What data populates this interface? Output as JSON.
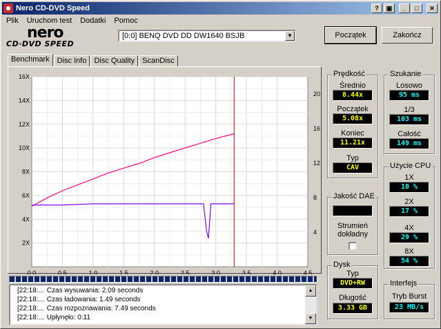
{
  "window": {
    "title": "Nero CD-DVD Speed",
    "buttons": {
      "help": "?",
      "minimize": "_",
      "maximize": "□",
      "close": "✕"
    }
  },
  "menu": [
    "Plik",
    "Uruchom test",
    "Dodatki",
    "Pomoc"
  ],
  "logo": {
    "brand": "nero",
    "product": "CD·DVD SPEED"
  },
  "drive": {
    "selected": "[0:0]  BENQ DVD DD DW1640 BSJB"
  },
  "actions": {
    "start": "Początek",
    "exit": "Zakończ"
  },
  "tabs": [
    "Benchmark",
    "Disc Info",
    "Disc Quality",
    "ScanDisc"
  ],
  "speed": {
    "title": "Prędkość",
    "average_label": "Średnio",
    "average": "8.44x",
    "start_label": "Początek",
    "start": "5.08x",
    "end_label": "Koniec",
    "end": "11.21x",
    "type_label": "Typ",
    "type": "CAV"
  },
  "seek": {
    "title": "Szukanie",
    "random_label": "Losowo",
    "random": "95 ms",
    "third_label": "1/3",
    "third": "103 ms",
    "full_label": "Całość",
    "full": "149 ms"
  },
  "cpu": {
    "title": "Użycie CPU",
    "rows": [
      {
        "label": "1X",
        "value": "10 %"
      },
      {
        "label": "2X",
        "value": "17 %"
      },
      {
        "label": "4X",
        "value": "29 %"
      },
      {
        "label": "8X",
        "value": "54 %"
      }
    ]
  },
  "dae": {
    "title": "Jakość DAE",
    "stream_label": "Strumień dokładny"
  },
  "disc": {
    "title": "Dysk",
    "type_label": "Typ",
    "type": "DVD+RW",
    "length_label": "Długość",
    "length": "3.33 GB"
  },
  "interface": {
    "title": "Interfejs",
    "burst_label": "Tryb Burst",
    "burst": "23 MB/s"
  },
  "progress": {
    "fraction": 1.0
  },
  "log": [
    {
      "ts": "[22:18:...",
      "msg": "Czas wysuwania: 2.09 seconds"
    },
    {
      "ts": "[22:18:...",
      "msg": "Czas ładowania: 1.49 seconds"
    },
    {
      "ts": "[22:18:...",
      "msg": "Czas rozpoznawania: 7.49 seconds"
    },
    {
      "ts": "[22:18:...",
      "msg": "Upłynęło:  0:11"
    }
  ],
  "chart_data": {
    "type": "line",
    "x_ticks": [
      "0.0",
      "0.5",
      "1.0",
      "1.5",
      "2.0",
      "2.5",
      "3.0",
      "3.5",
      "4.0",
      "4.5"
    ],
    "y_left_ticks": [
      "2X",
      "4X",
      "6X",
      "8X",
      "10X",
      "12X",
      "14X",
      "16X"
    ],
    "y_right_ticks": [
      "4",
      "8",
      "12",
      "16",
      "20"
    ],
    "xlim": [
      0,
      4.5
    ],
    "ylim": [
      0,
      16
    ],
    "y2lim": [
      0,
      22
    ],
    "grid": true,
    "end_marker_x": 3.3,
    "series": [
      {
        "color": "#ff0080",
        "x": [
          0,
          0.25,
          0.5,
          0.75,
          1.0,
          1.25,
          1.5,
          1.75,
          2.0,
          2.25,
          2.5,
          2.75,
          3.0,
          3.3
        ],
        "y": [
          5.1,
          5.8,
          6.4,
          6.9,
          7.4,
          7.9,
          8.3,
          8.7,
          9.2,
          9.6,
          10.0,
          10.4,
          10.8,
          11.2
        ]
      },
      {
        "color": "#8000ff",
        "x": [
          0,
          0.5,
          1.0,
          1.5,
          2.0,
          2.5,
          2.8,
          2.85,
          2.88,
          2.92,
          3.0,
          3.3
        ],
        "y": [
          5.2,
          5.2,
          5.3,
          5.3,
          5.3,
          5.3,
          5.3,
          3.0,
          2.4,
          5.3,
          5.3,
          5.3
        ]
      }
    ]
  }
}
